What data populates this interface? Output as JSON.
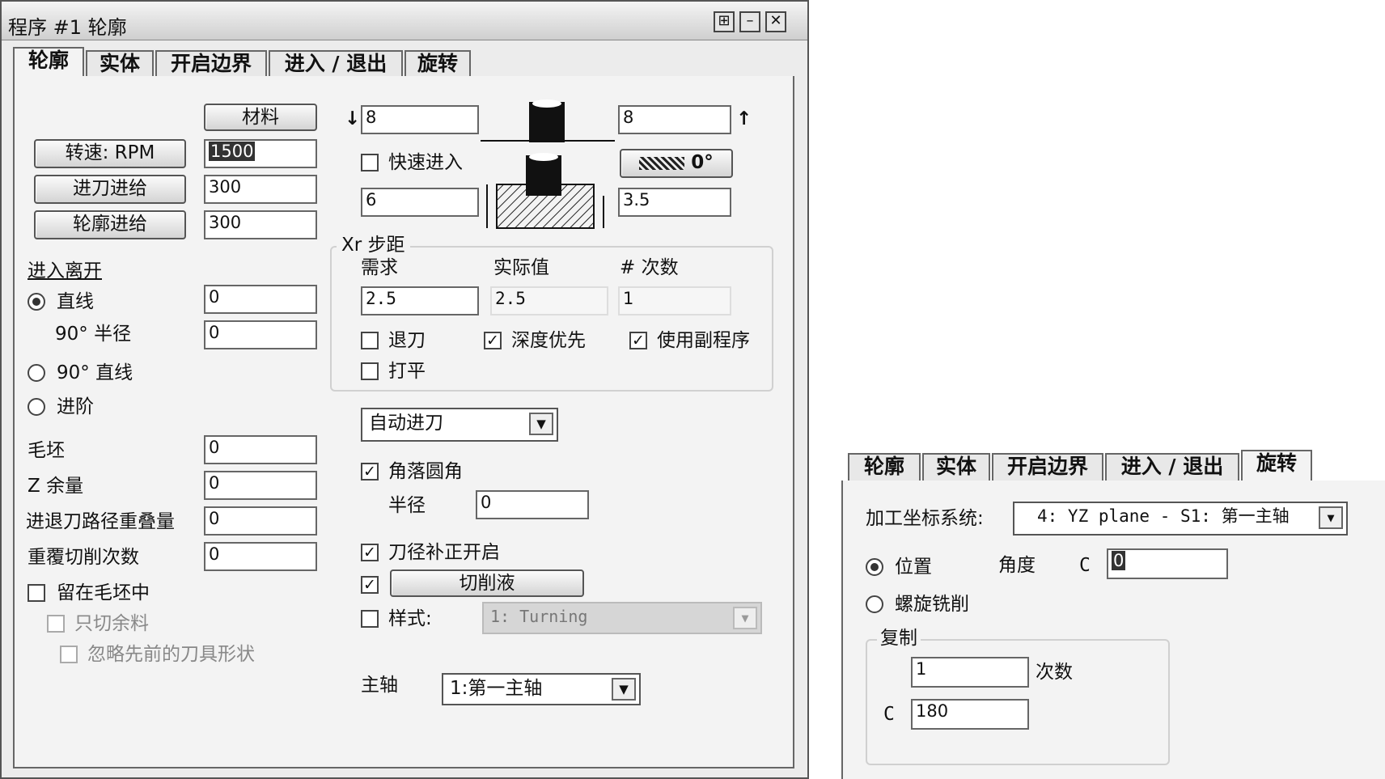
{
  "left_window": {
    "title": "程序 #1 轮廓",
    "title_buttons": [
      "pin-icon",
      "minimize-icon",
      "close-icon"
    ],
    "tabs": [
      "轮廓",
      "实体",
      "开启边界",
      "进入 / 退出",
      "旋转"
    ],
    "active_tab": "轮廓",
    "material_button": "材料",
    "speed_button": "转速: RPM",
    "feed_button": "进刀进给",
    "contour_feed_button": "轮廓进给",
    "speed_value": "1500",
    "feed_value": "300",
    "contour_feed_value": "300",
    "entry_exit_label": "进入离开",
    "radio_line": "直线",
    "radius_label": "90° 半径",
    "radio_90_line": "90° 直线",
    "radio_step": "进阶",
    "line_value": "0",
    "radius_value": "0",
    "stock_label": "毛坯",
    "stock_value": "0",
    "z_allow_label": "Z 余量",
    "z_allow_value": "0",
    "overlap_label": "进退刀路径重叠量",
    "overlap_value": "0",
    "repeat_label": "重覆切削次数",
    "repeat_value": "0",
    "stay_in_stock": "留在毛坯中",
    "cut_remain_only": "只切余料",
    "ignore_prev_tool": "忽略先前的刀具形状",
    "down_arrow": "↓",
    "up_arrow": "↑",
    "top_left_value": "8",
    "top_right_value": "8",
    "rapid_entry": "快速进入",
    "angle_button": "0°",
    "depth_left_value": "6",
    "depth_right_value": "3.5",
    "xr_label": "Xr 步距",
    "col_required": "需求",
    "col_actual": "实际值",
    "col_count": "# 次数",
    "required_value": "2.5",
    "actual_value": "2.5",
    "count_value": "1",
    "retract": "退刀",
    "depth_first": "深度优先",
    "use_subprogram": "使用副程序",
    "flatten": "打平",
    "auto_feed_select": "自动进刀",
    "corner_round": "角落圆角",
    "corner_radius_label": "半径",
    "corner_radius_value": "0",
    "cutter_comp": "刀径补正开启",
    "coolant_button": "切削液",
    "style_label": "样式:",
    "style_select": "1: Turning",
    "spindle_label": "主轴",
    "spindle_select": "1:第一主轴"
  },
  "right_panel": {
    "tabs": [
      "轮廓",
      "实体",
      "开启边界",
      "进入 / 退出",
      "旋转"
    ],
    "active_tab": "旋转",
    "coord_label": "加工坐标系统:",
    "coord_select": "4: YZ plane - S1: 第一主轴",
    "radio_position": "位置",
    "angle_label": "角度",
    "c_label": "C",
    "angle_value": "0",
    "radio_helical": "螺旋铣削",
    "copy_group": "复制",
    "copy_count_value": "1",
    "copy_count_label": "次数",
    "copy_c_label": "C",
    "copy_c_value": "180"
  }
}
